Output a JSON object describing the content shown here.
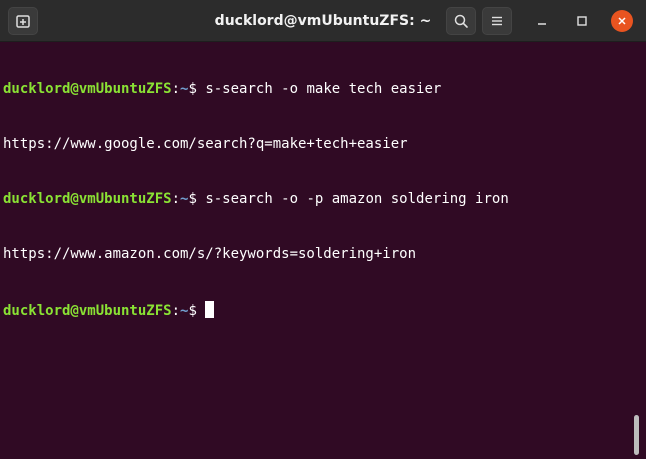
{
  "window": {
    "title": "ducklord@vmUbuntuZFS: ~",
    "titlebar_color": "#2c2c2c",
    "close_button_color": "#e95420"
  },
  "toolbar": {
    "new_tab_icon": "new-tab-icon",
    "search_icon": "search-icon",
    "menu_icon": "hamburger-menu-icon"
  },
  "terminal": {
    "background": "#300a24",
    "prompt_user_color": "#8ae234",
    "prompt_path_color": "#729fcf",
    "lines": [
      {
        "type": "prompt",
        "user_host": "ducklord@vmUbuntuZFS",
        "sep": ":",
        "path": "~",
        "symbol": "$ ",
        "command": "s-search -o make tech easier"
      },
      {
        "type": "output",
        "text": "https://www.google.com/search?q=make+tech+easier"
      },
      {
        "type": "prompt",
        "user_host": "ducklord@vmUbuntuZFS",
        "sep": ":",
        "path": "~",
        "symbol": "$ ",
        "command": "s-search -o -p amazon soldering iron"
      },
      {
        "type": "output",
        "text": "https://www.amazon.com/s/?keywords=soldering+iron"
      },
      {
        "type": "prompt",
        "user_host": "ducklord@vmUbuntuZFS",
        "sep": ":",
        "path": "~",
        "symbol": "$ ",
        "command": ""
      }
    ]
  }
}
